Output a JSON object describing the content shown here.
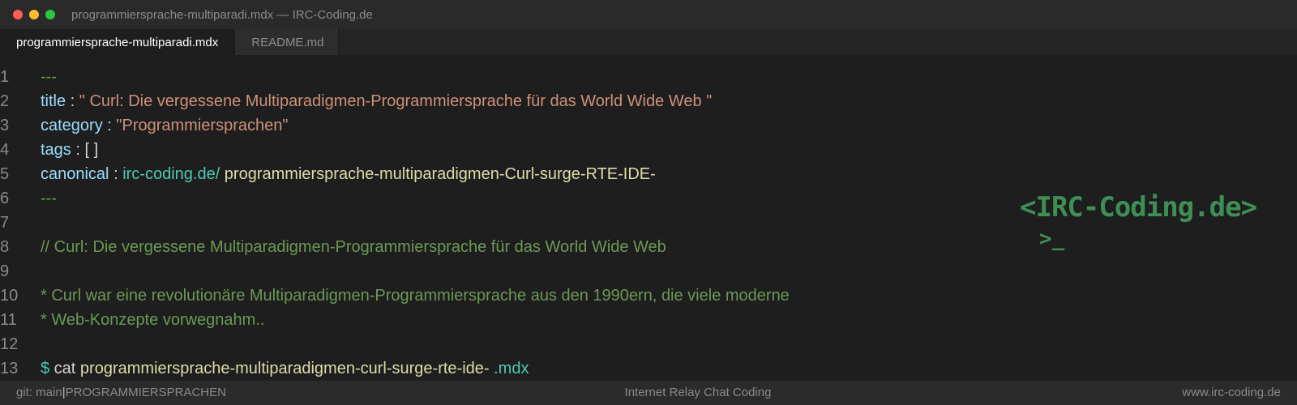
{
  "window": {
    "title": "programmiersprache-multiparadi.mdx — IRC-Coding.de"
  },
  "tabs": [
    {
      "label": "programmiersprache-multiparadi.mdx",
      "active": true
    },
    {
      "label": "README.md",
      "active": false
    }
  ],
  "editor": {
    "lines": [
      {
        "num": "1",
        "frontmatter": "---"
      },
      {
        "num": "2",
        "key": "title",
        "colon": " : ",
        "value": "\" Curl: Die vergessene Multiparadigmen-Programmiersprache für das World Wide Web \""
      },
      {
        "num": "3",
        "key": "category",
        "colon": " : ",
        "value": "\"Programmiersprachen\""
      },
      {
        "num": "4",
        "key": "tags",
        "colon": " : ",
        "value": "[ ]"
      },
      {
        "num": "5",
        "key": "canonical",
        "colon": " : ",
        "domain": "irc-coding.de/",
        "path": " programmiersprache-multiparadigmen-Curl-surge-RTE-IDE-"
      },
      {
        "num": "6",
        "frontmatter": "---"
      },
      {
        "num": "7"
      },
      {
        "num": "8",
        "comment": "// Curl: Die vergessene Multiparadigmen-Programmiersprache für das World Wide Web"
      },
      {
        "num": "9"
      },
      {
        "num": "10",
        "comment": "* Curl war eine revolutionäre Multiparadigmen-Programmiersprache aus den 1990ern, die viele moderne"
      },
      {
        "num": "11",
        "comment": "* Web-Konzepte vorwegnahm.."
      },
      {
        "num": "12"
      },
      {
        "num": "13",
        "dollar": "$",
        "cmd": " cat",
        "file": " programmiersprache-multiparadigmen-curl-surge-rte-ide-",
        "ext": " .mdx"
      }
    ]
  },
  "logo": {
    "text": "<IRC-Coding.de>",
    "prompt": ">_"
  },
  "status": {
    "left_branch": "git: main",
    "separator": "|",
    "left_category": "PROGRAMMIERSPRACHEN",
    "center": "Internet Relay Chat Coding",
    "right": "www.irc-coding.de"
  },
  "colors": {
    "background": "#1e1e1e",
    "comment": "#6a9955",
    "key": "#9cdcfe",
    "string": "#ce9178",
    "teal": "#4ec9b0",
    "logo": "#3d8f55"
  }
}
